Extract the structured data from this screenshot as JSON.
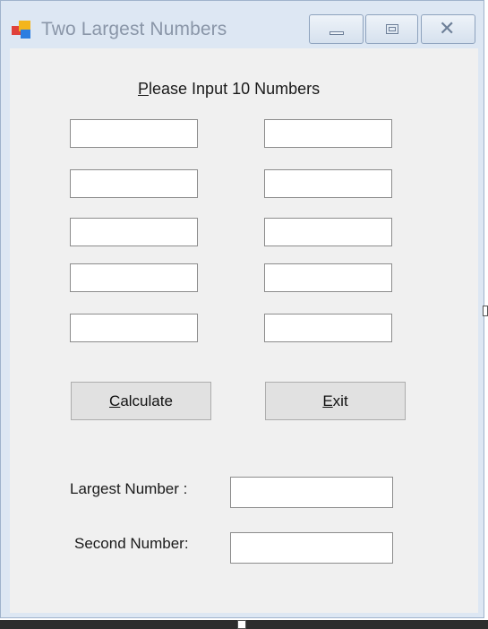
{
  "window": {
    "title": "Two Largest Numbers",
    "icon": "app-windows-icon",
    "caption_buttons": [
      "minimize-icon",
      "maximize-icon",
      "close-icon"
    ],
    "close_glyph": "✕"
  },
  "form": {
    "heading_prefix": "P",
    "heading_rest": "lease Input 10 Numbers",
    "inputs": [
      "",
      "",
      "",
      "",
      "",
      "",
      "",
      "",
      "",
      ""
    ],
    "calculate": {
      "mnemonic": "C",
      "rest": "alculate"
    },
    "exit": {
      "mnemonic": "E",
      "rest": "xit"
    },
    "largest_label": "Largest Number :",
    "largest_value": "",
    "second_label": "Second Number:",
    "second_value": ""
  }
}
